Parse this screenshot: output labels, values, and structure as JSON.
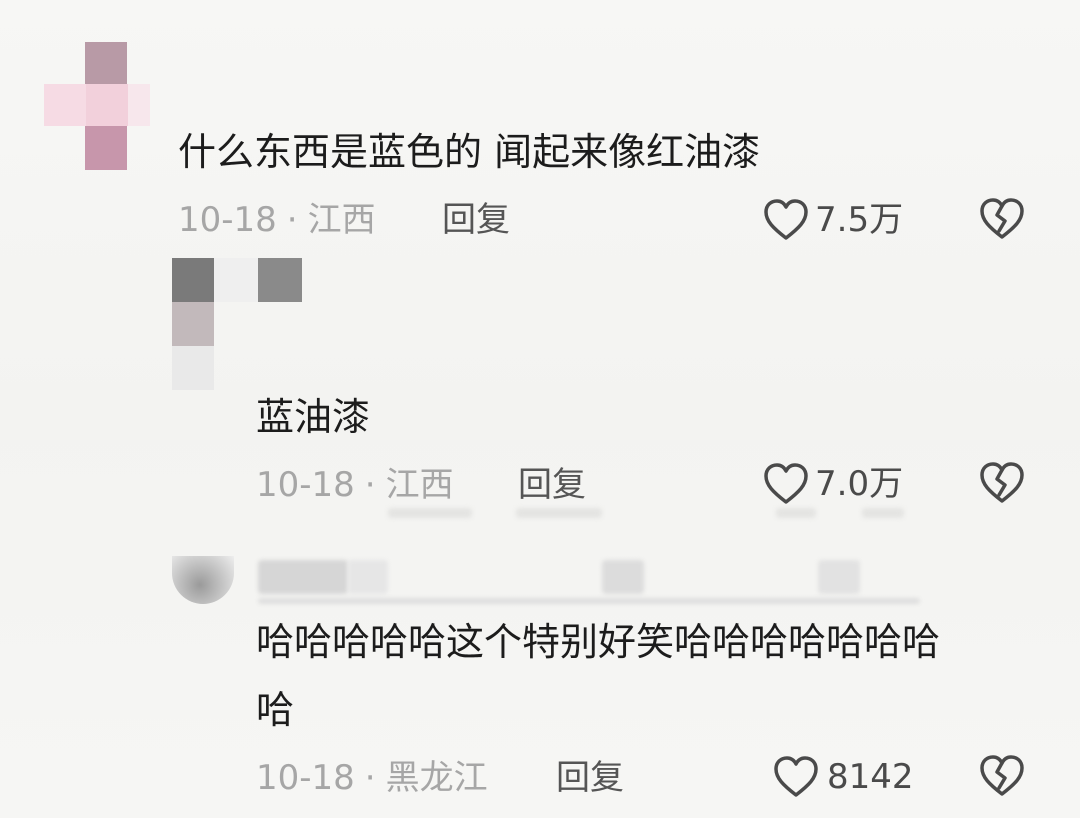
{
  "comments": [
    {
      "text": "什么东西是蓝色的 闻起来像红油漆",
      "date": "10-18",
      "location": "江西",
      "reply_label": "回复",
      "likes": "7.5万",
      "like_icon": "heart-outline-icon",
      "dislike_icon": "broken-heart-icon"
    },
    {
      "text": "蓝油漆",
      "date": "10-18",
      "location": "江西",
      "reply_label": "回复",
      "likes": "7.0万",
      "like_icon": "heart-outline-icon",
      "dislike_icon": "broken-heart-icon"
    },
    {
      "text_line1": "哈哈哈哈哈这个特别好笑哈哈哈哈哈哈哈",
      "text_line2": "哈",
      "date": "10-18",
      "location": "黑龙江",
      "reply_label": "回复",
      "likes": "8142",
      "like_icon": "heart-outline-icon",
      "dislike_icon": "broken-heart-icon"
    }
  ],
  "meta_separator": "·",
  "colors": {
    "text": "#1c1c1c",
    "meta": "#a6a6a6",
    "icon": "#4a4a4a"
  }
}
